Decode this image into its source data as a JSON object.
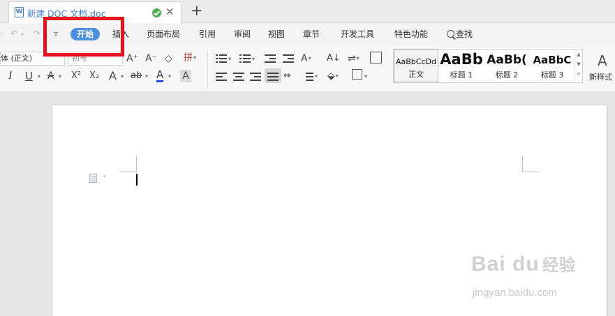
{
  "tabbar": {
    "doc_icon_glyph": "W",
    "doc_title": "新建 DOC 文档.doc",
    "close_glyph": "✕",
    "new_tab_glyph": "+"
  },
  "quick_access": {
    "undo_glyph": "↶",
    "redo_glyph": "↷",
    "customize_glyph": "▿"
  },
  "menu_tabs": [
    {
      "label": "开始",
      "active": true
    },
    {
      "label": "插入"
    },
    {
      "label": "页面布局"
    },
    {
      "label": "引用"
    },
    {
      "label": "审阅"
    },
    {
      "label": "视图"
    },
    {
      "label": "章节"
    },
    {
      "label": "开发工具"
    },
    {
      "label": "特色功能"
    }
  ],
  "search_label": "查找",
  "ribbon": {
    "font_name": "体 (正文)",
    "font_size_placeholder": "初号",
    "grow_font": "A⁺",
    "shrink_font": "A⁻",
    "phonetic": "拼",
    "italic": "I",
    "underline": "U",
    "strike": "A",
    "superscript": "X²",
    "subscript": "X₂",
    "text_effect": "A",
    "highlight": "ab",
    "font_color": "A",
    "char_shading": "A",
    "sort_glyph": "A↓",
    "distributed_glyph": "⇔"
  },
  "styles": [
    {
      "sample": "AaBbCcDd",
      "label": "正文",
      "selected": true
    },
    {
      "sample": "AaBb",
      "label": "标题 1"
    },
    {
      "sample": "AaBb(",
      "label": "标题 2"
    },
    {
      "sample": "AaBbC",
      "label": "标题 3"
    }
  ],
  "new_style": {
    "icon": "A",
    "label": "新样式"
  },
  "watermark": {
    "logo": "Bai du",
    "cn": "经验",
    "url": "jingyan.baidu.com"
  },
  "colors": {
    "accent": "#4c8fe0",
    "highlight_box": "#e8101b",
    "saved_check": "#4caf50",
    "font_color_bar": "#1a4fd6"
  }
}
